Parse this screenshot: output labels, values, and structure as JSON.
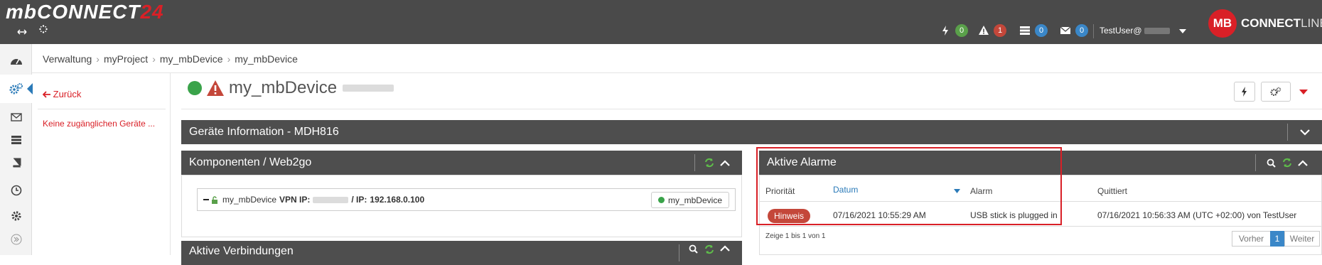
{
  "header": {
    "logo_main": "mbCONNECT",
    "logo_accent": "24",
    "stats": [
      {
        "icon": "lightning-icon",
        "count": "0",
        "color": "#5aa04a"
      },
      {
        "icon": "warning-icon",
        "count": "1",
        "color": "#c4473a"
      },
      {
        "icon": "server-icon",
        "count": "0",
        "color": "#3a87c8"
      },
      {
        "icon": "envelope-icon",
        "count": "0",
        "color": "#3a87c8"
      }
    ],
    "user": "TestUser@",
    "brand_circle": "MB",
    "brand_text": "CONNECT",
    "brand_text_thin": "LINE"
  },
  "breadcrumb": [
    "Verwaltung",
    "myProject",
    "my_mbDevice",
    "my_mbDevice"
  ],
  "left_panel": {
    "back_label": "Zurück",
    "empty_text": "Keine zugänglichen Geräte ..."
  },
  "device": {
    "name": "my_mbDevice"
  },
  "panels": {
    "info_title": "Geräte Information - MDH816",
    "components_title": "Komponenten / Web2go",
    "connections_title": "Aktive Verbindungen",
    "alarms_title": "Aktive Alarme"
  },
  "vpn": {
    "device": "my_mbDevice",
    "vpn_label": "VPN IP:",
    "ip_label": "/ IP:",
    "ip": "192.168.0.100",
    "button": "my_mbDevice"
  },
  "alarms": {
    "columns": [
      "Priorität",
      "Datum",
      "Alarm",
      "Quittiert"
    ],
    "rows": [
      {
        "priority": "Hinweis",
        "date": "07/16/2021 10:55:29 AM",
        "alarm": "USB stick is plugged in",
        "ack": "07/16/2021 10:56:33 AM (UTC +02:00) von TestUser"
      }
    ],
    "footer": "Zeige 1 bis 1 von 1",
    "pager": {
      "prev": "Vorher",
      "page": "1",
      "next": "Weiter"
    }
  },
  "colors": {
    "accent": "#d92027",
    "header_bg": "#4a4a4a",
    "link_blue": "#2a7ab8"
  }
}
